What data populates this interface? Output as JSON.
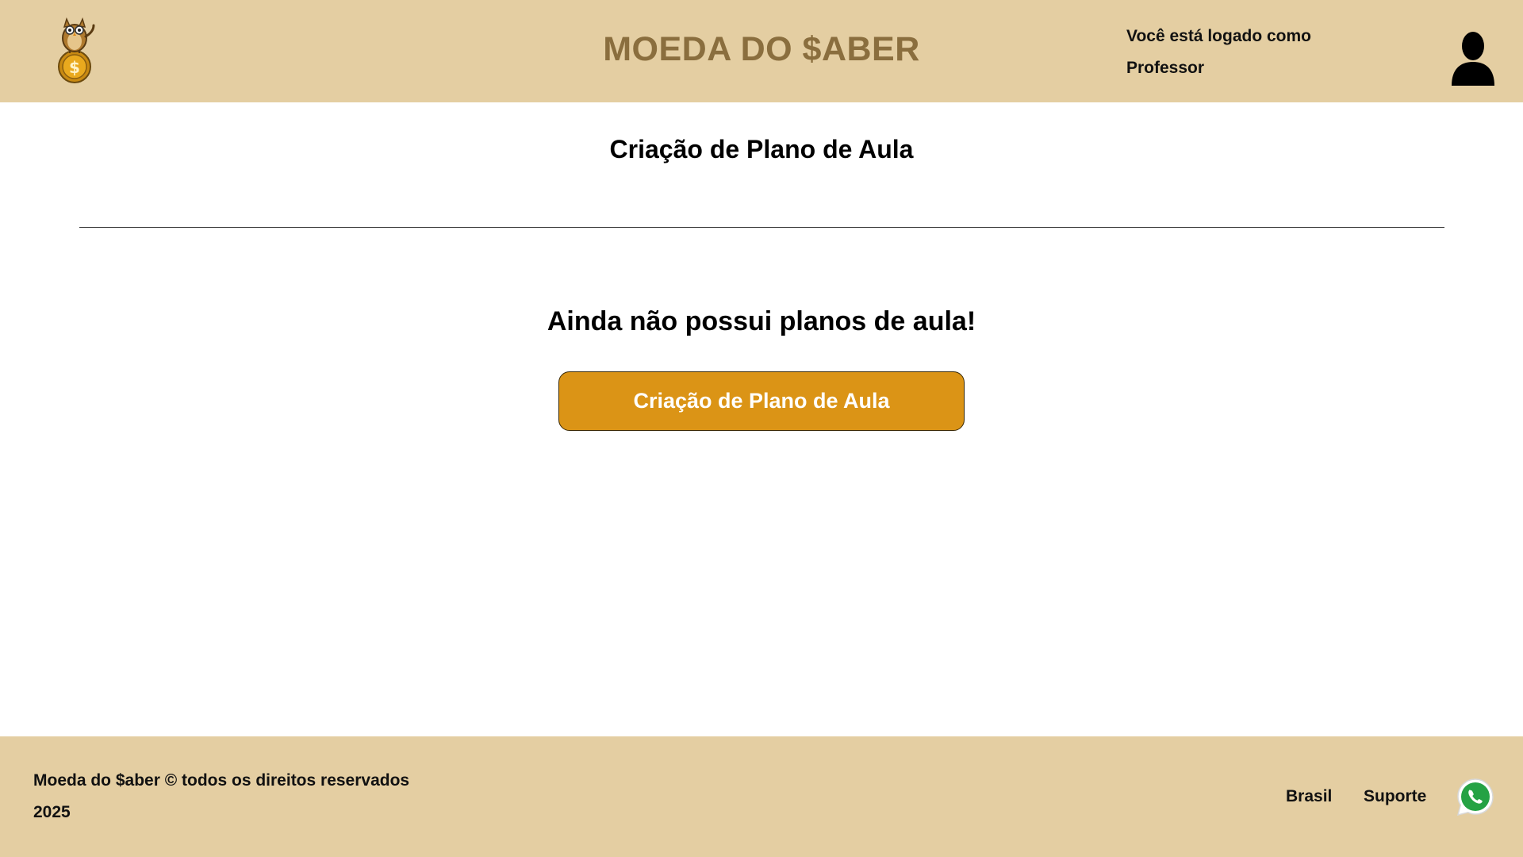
{
  "header": {
    "brand_title": "MOEDA DO $ABER",
    "login_line1": "Você está logado como",
    "login_line2": "Professor",
    "logo_icon": "owl-coin-logo",
    "avatar_icon": "user-silhouette-icon"
  },
  "main": {
    "page_title": "Criação de Plano de Aula",
    "empty_message": "Ainda não possui planos de aula!",
    "create_button_label": "Criação de Plano de Aula"
  },
  "footer": {
    "copyright_line1": "Moeda do $aber © todos os direitos reservados",
    "copyright_line2": "2025",
    "link_brasil": "Brasil",
    "link_suporte": "Suporte",
    "whatsapp_icon": "whatsapp-icon"
  },
  "colors": {
    "header_bg": "#e4cea2",
    "brand_text": "#8a6e3e",
    "button_bg": "#db9416",
    "button_text": "#ffffff",
    "footer_bg": "#e4cea2"
  }
}
